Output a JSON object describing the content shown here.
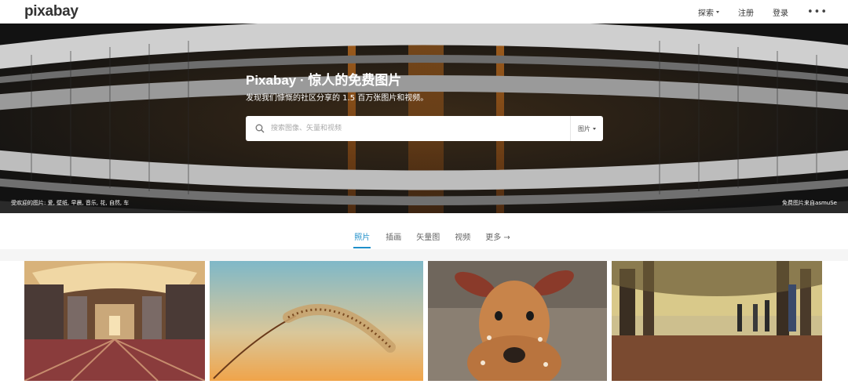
{
  "header": {
    "logo": "pixabay",
    "nav": {
      "explore": "探索",
      "signup": "注册",
      "login": "登录",
      "more": "•••"
    }
  },
  "hero": {
    "title": "Pixabay · 惊人的免费图片",
    "subtitle": "发现我们慷慨的社区分享的 1.5 百万张图片和视频。",
    "search_placeholder": "搜索图像、矢量和视频",
    "search_type": "图片",
    "popular": "受欢迎的图片: 爱, 壁纸, 早晨, 音乐, 花, 自然, 车",
    "credit": "免费图片来自asmuSe"
  },
  "tabs": [
    "照片",
    "插画",
    "矢量图",
    "视频"
  ],
  "tab_more": "更多 →",
  "gallery": [
    {
      "icon": "metro-station-photo"
    },
    {
      "icon": "grass-seed-photo"
    },
    {
      "icon": "deer-photo"
    },
    {
      "icon": "autumn-park-photo"
    }
  ],
  "colors": {
    "accent": "#1f8fca"
  }
}
